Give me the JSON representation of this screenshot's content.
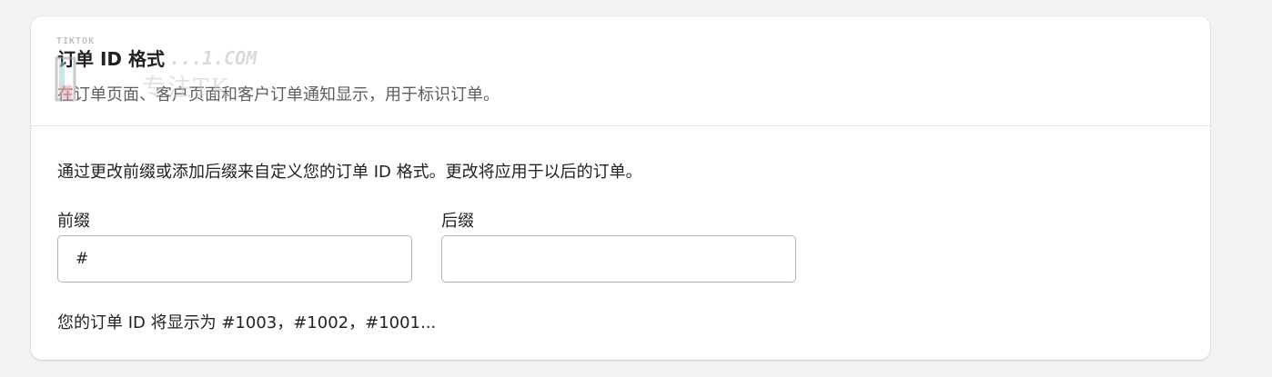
{
  "section": {
    "title": "订单 ID 格式",
    "subtitle": "在订单页面、客户页面和客户订单通知显示，用于标识订单。",
    "description": "通过更改前缀或添加后缀来自定义您的订单 ID 格式。更改将应用于以后的订单。",
    "prefix": {
      "label": "前缀",
      "value": "#",
      "placeholder": ""
    },
    "suffix": {
      "label": "后缀",
      "value": "",
      "placeholder": ""
    },
    "preview_text": "您的订单 ID 将显示为 #1003，#1002，#1001..."
  },
  "watermark": {
    "brand": "TIKTOK",
    "domain": "...1.COM",
    "chinese_text": "专注TK"
  },
  "colors": {
    "page_background": "#f1f2f3",
    "card_background": "#ffffff",
    "text_primary": "#202223",
    "text_subdued": "#5c5f62",
    "divider": "#e1e3e5",
    "input_border": "#aeb4b9"
  }
}
